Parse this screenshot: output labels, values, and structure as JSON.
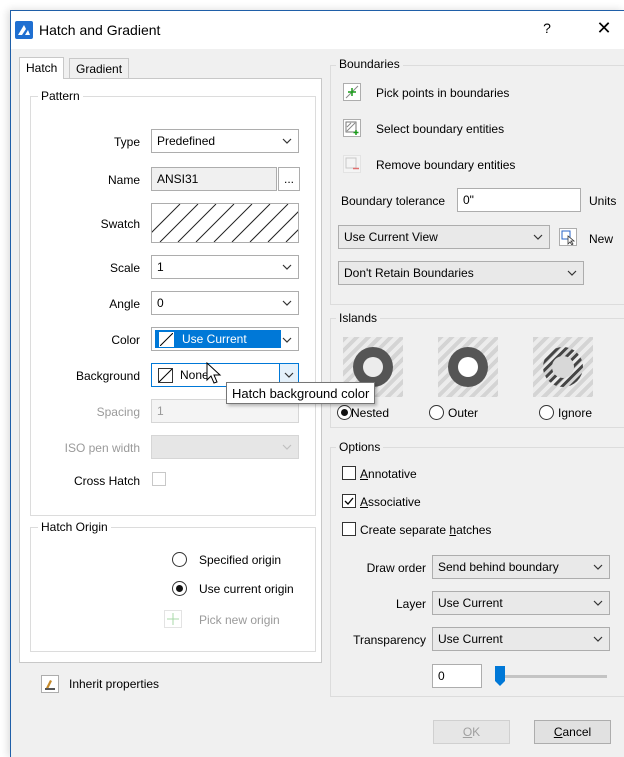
{
  "window": {
    "title": "Hatch and Gradient",
    "help": "?",
    "close": "✕"
  },
  "tabs": [
    {
      "label": "Hatch",
      "active": true
    },
    {
      "label": "Gradient",
      "active": false
    }
  ],
  "pattern": {
    "group_title": "Pattern",
    "type_label": "Type",
    "type_value": "Predefined",
    "name_label": "Name",
    "name_value": "ANSI31",
    "name_browse": "...",
    "swatch_label": "Swatch",
    "scale_label": "Scale",
    "scale_value": "1",
    "angle_label": "Angle",
    "angle_value": "0",
    "color_label": "Color",
    "color_value": "Use Current",
    "background_label": "Background",
    "background_value": "None",
    "spacing_label": "Spacing",
    "spacing_value": "1",
    "iso_label": "ISO pen width",
    "iso_value": "",
    "crosshatch_label": "Cross Hatch"
  },
  "tooltip": "Hatch background color",
  "hatch_origin": {
    "group_title": "Hatch Origin",
    "specified": "Specified origin",
    "use_current": "Use current origin",
    "pick_new": "Pick new origin"
  },
  "inherit": {
    "label": "Inherit properties"
  },
  "boundaries": {
    "group_title": "Boundaries",
    "pick_points": "Pick points in boundaries",
    "select_entities": "Select boundary entities",
    "remove_entities": "Remove boundary entities",
    "tolerance_label": "Boundary tolerance",
    "tolerance_value": "0\"",
    "units_label": "Units",
    "view_value": "Use Current View",
    "new_label": "New",
    "retain_value": "Don't Retain Boundaries"
  },
  "islands": {
    "group_title": "Islands",
    "nested": "Nested",
    "outer": "Outer",
    "ignore": "Ignore",
    "selected": "Nested"
  },
  "options": {
    "group_title": "Options",
    "annotative": {
      "pre": "",
      "u": "A",
      "post": "nnotative",
      "checked": false
    },
    "associative": {
      "pre": "",
      "u": "A",
      "post": "ssociative",
      "checked": true
    },
    "separate": {
      "pre": "Create separate ",
      "u": "h",
      "post": "atches",
      "checked": false
    },
    "draw_order_label": "Draw order",
    "draw_order_value": "Send behind boundary",
    "layer_label": "Layer",
    "layer_value": "Use Current",
    "transparency_label": "Transparency",
    "transparency_value": "Use Current",
    "transparency_number": "0",
    "transparency_level": 0
  },
  "footer": {
    "ok": {
      "u": "O",
      "post": "K"
    },
    "cancel": {
      "u": "C",
      "post": "ancel"
    }
  },
  "colors": {
    "accent": "#0078d7",
    "title_icon": "#1f6fd1",
    "disabled": "#9a9a9a"
  }
}
